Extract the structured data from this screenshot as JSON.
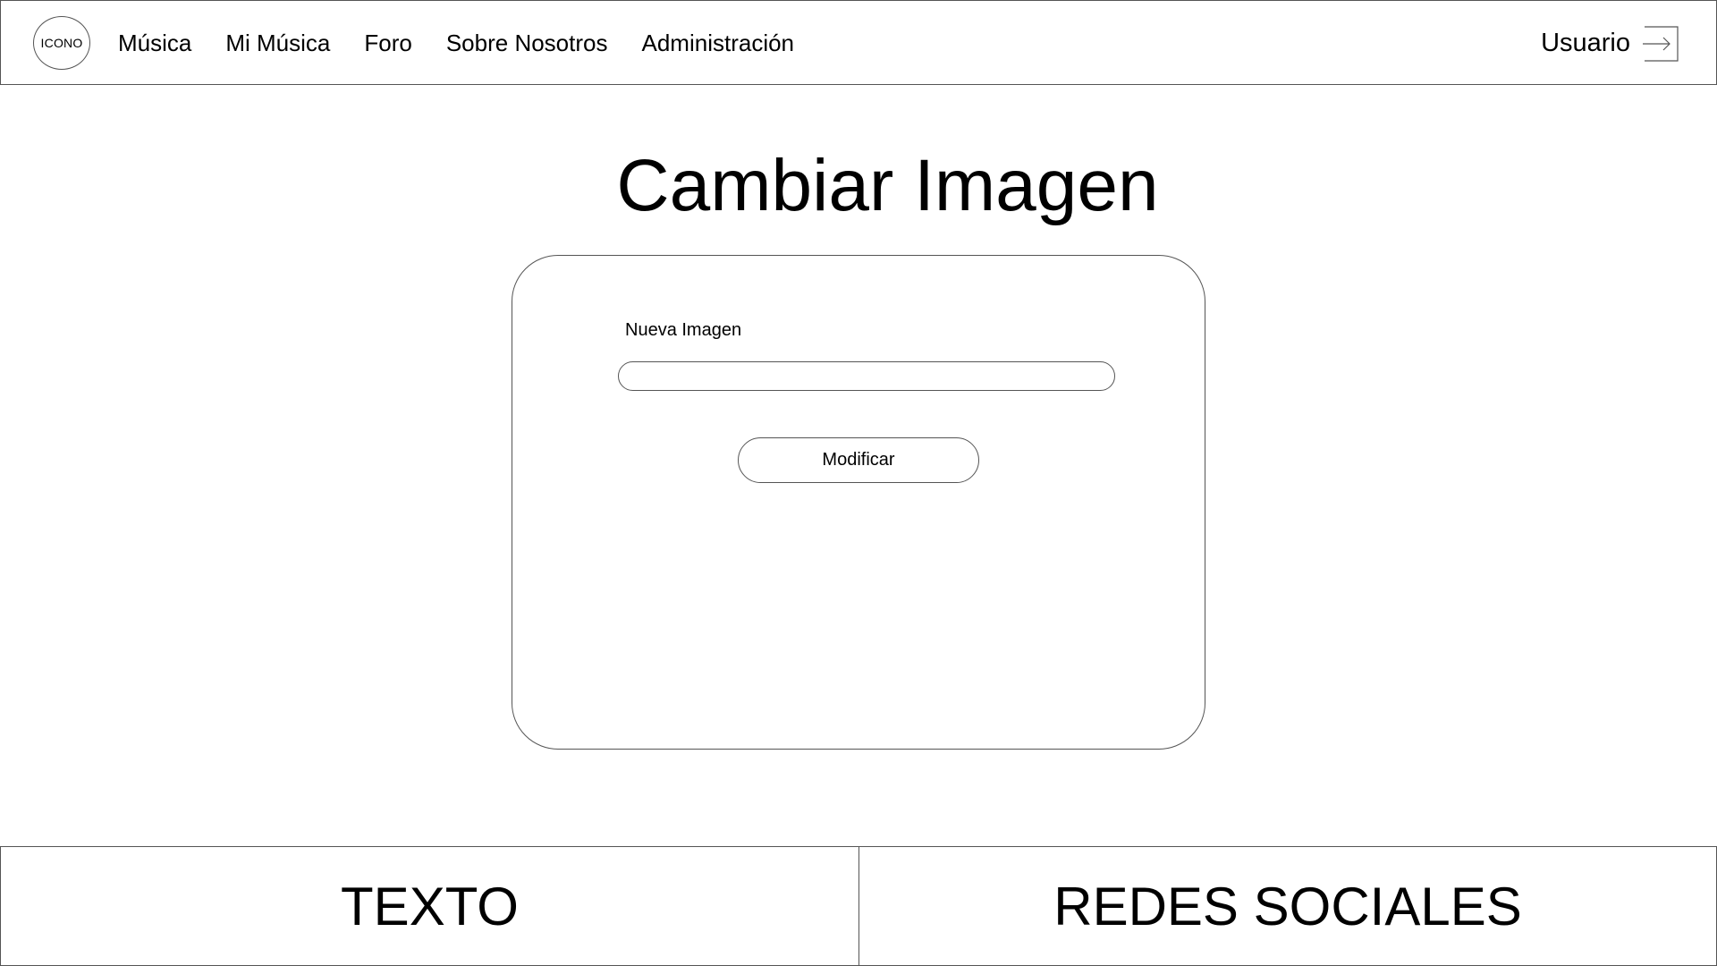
{
  "header": {
    "logo_text": "ICONO",
    "nav": [
      {
        "label": "Música"
      },
      {
        "label": "Mi Música"
      },
      {
        "label": "Foro"
      },
      {
        "label": "Sobre Nosotros"
      },
      {
        "label": "Administración"
      }
    ],
    "user_label": "Usuario",
    "logout_icon": "logout-arrow-icon"
  },
  "main": {
    "title": "Cambiar Imagen",
    "form": {
      "field_label": "Nueva Imagen",
      "field_value": "",
      "field_placeholder": "",
      "submit_label": "Modificar"
    }
  },
  "footer": {
    "left_text": "TEXTO",
    "right_text": "REDES SOCIALES"
  }
}
